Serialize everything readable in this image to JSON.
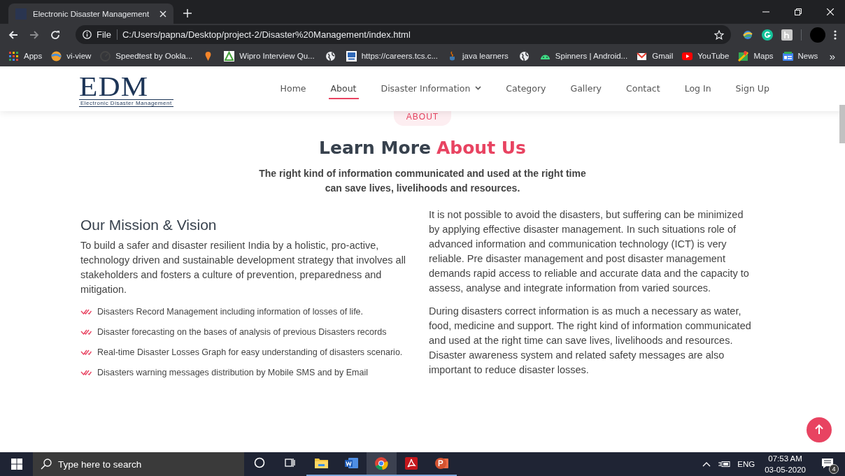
{
  "browser": {
    "tab_title": "Electronic Disaster Management",
    "url_scheme": "File",
    "url": "C:/Users/papna/Desktop/project-2/Disaster%20Management/index.html",
    "bookmarks": [
      {
        "kind": "link",
        "label": "Apps"
      },
      {
        "kind": "link",
        "label": "vi-view"
      },
      {
        "kind": "link",
        "label": "Speedtest by Ookla..."
      },
      {
        "kind": "icon"
      },
      {
        "kind": "link",
        "label": "Wipro Interview Qu..."
      },
      {
        "kind": "icon"
      },
      {
        "kind": "link",
        "label": "https://careers.tcs.c..."
      },
      {
        "kind": "link",
        "label": "java learners"
      },
      {
        "kind": "icon"
      },
      {
        "kind": "link",
        "label": "Spinners | Android..."
      },
      {
        "kind": "link",
        "label": "Gmail"
      },
      {
        "kind": "link",
        "label": "YouTube"
      },
      {
        "kind": "link",
        "label": "Maps"
      },
      {
        "kind": "link",
        "label": "News"
      }
    ],
    "more": "»"
  },
  "site": {
    "logo": "EDM",
    "logo_tagline": "Electronic Disaster Management",
    "nav": [
      {
        "label": "Home",
        "selected": false,
        "dropdown": false
      },
      {
        "label": "About",
        "selected": true,
        "dropdown": false
      },
      {
        "label": "Disaster Information",
        "selected": false,
        "dropdown": true
      },
      {
        "label": "Category",
        "selected": false,
        "dropdown": false
      },
      {
        "label": "Gallery",
        "selected": false,
        "dropdown": false
      },
      {
        "label": "Contact",
        "selected": false,
        "dropdown": false
      },
      {
        "label": "Log In",
        "selected": false,
        "dropdown": false
      },
      {
        "label": "Sign Up",
        "selected": false,
        "dropdown": false
      }
    ]
  },
  "section": {
    "badge": "ABOUT",
    "heading": "Learn More",
    "heading_accent": "About Us",
    "subtitle_lines": [
      "The right kind of information communicated and used at the right time",
      "can save lives, livelihoods and resources."
    ],
    "mission_title": "Our Mission & Vision",
    "mission_text": "To build a safer and disaster resilient India by a holistic, pro-active, technology driven and sustainable development strategy that involves all stakeholders and fosters a culture of prevention, preparedness and mitigation.",
    "features": [
      "Disasters Record Management including information of losses of life.",
      "Disaster forecasting on the bases of analysis of previous Disasters records",
      "Real-time Disaster Losses Graph for easy understanding of disasters scenario.",
      "Disasters warning messages distribution by Mobile SMS and by Email"
    ],
    "paragraphs": [
      "It is not possible to avoid the disasters, but suffering can be minimized by applying effective disaster management. In such situations role of advanced information and communication technology (ICT) is very reliable. Pre disaster management and post disaster management demands rapid access to reliable and accurate data and the capacity to assess, analyse and integrate information from varied sources.",
      "During disasters correct information is as much a necessary as water, food, medicine and support. The right kind of information communicated and used at the right time can save lives, livelihoods and resources. Disaster awareness system and related safety messages are also important to reduce disaster losses."
    ]
  },
  "taskbar": {
    "search_placeholder": "Type here to search",
    "language": "ENG",
    "time": "07:53 AM",
    "date": "03-05-2020",
    "notifications": "4"
  }
}
